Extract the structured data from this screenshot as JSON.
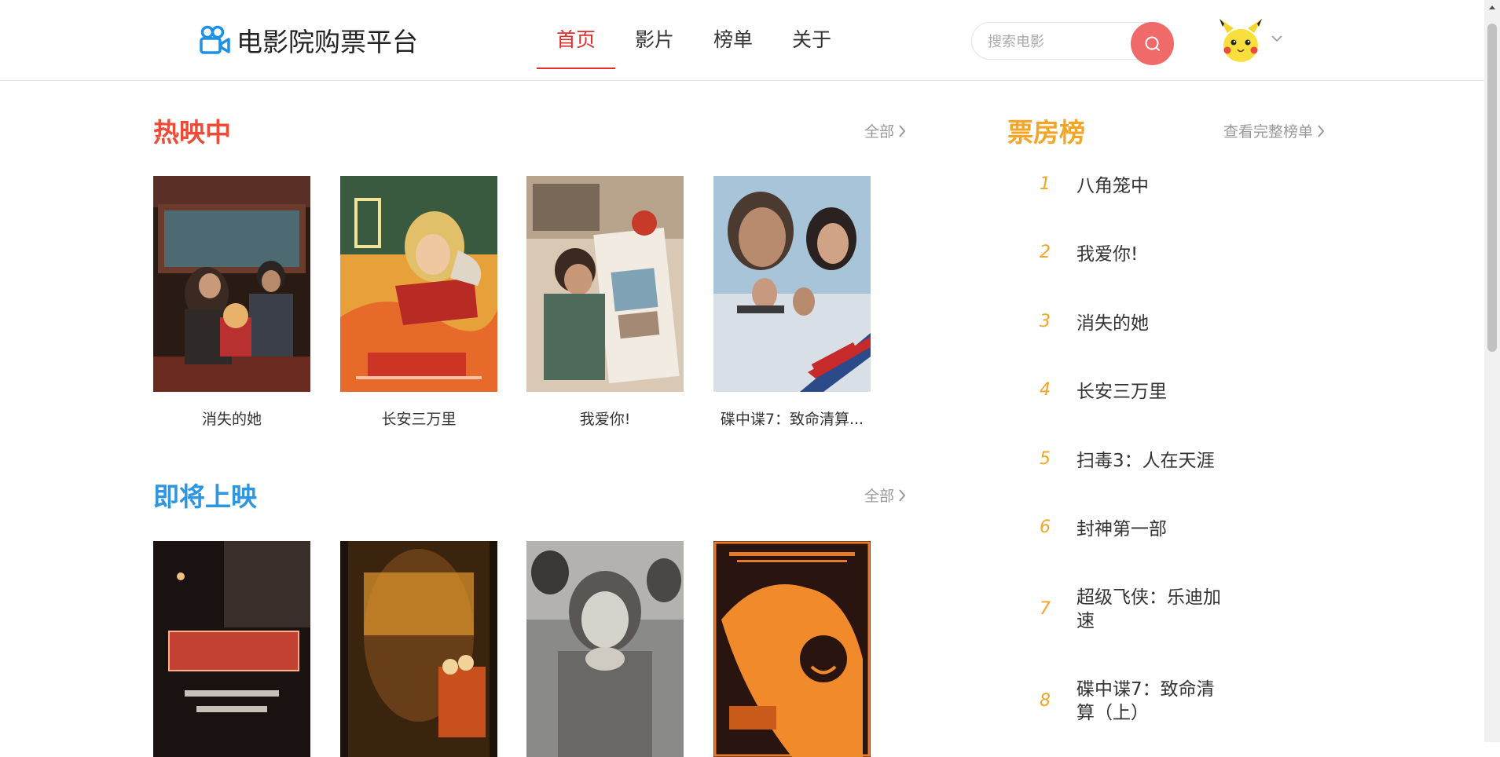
{
  "header": {
    "logo_text": "电影院购票平台",
    "nav": [
      {
        "label": "首页",
        "active": true
      },
      {
        "label": "影片",
        "active": false
      },
      {
        "label": "榜单",
        "active": false
      },
      {
        "label": "关于",
        "active": false
      }
    ],
    "search_placeholder": "搜索电影",
    "accent_color": "#e62b2b"
  },
  "hot": {
    "title": "热映中",
    "more": "全部",
    "movies": [
      {
        "name": "消失的她"
      },
      {
        "name": "长安三万里"
      },
      {
        "name": "我爱你!"
      },
      {
        "name": "碟中谍7：致命清算..."
      }
    ]
  },
  "upcoming": {
    "title": "即将上映",
    "more": "全部",
    "movies": [
      {
        "name": ""
      },
      {
        "name": ""
      },
      {
        "name": ""
      },
      {
        "name": ""
      }
    ]
  },
  "box_office": {
    "title": "票房榜",
    "more": "查看完整榜单",
    "items": [
      {
        "rank": "1",
        "name": "八角笼中"
      },
      {
        "rank": "2",
        "name": "我爱你!"
      },
      {
        "rank": "3",
        "name": "消失的她"
      },
      {
        "rank": "4",
        "name": "长安三万里"
      },
      {
        "rank": "5",
        "name": "扫毒3：人在天涯"
      },
      {
        "rank": "6",
        "name": "封神第一部"
      },
      {
        "rank": "7",
        "name": "超级飞侠：乐迪加速"
      },
      {
        "rank": "8",
        "name": "碟中谍7：致命清算（上）"
      }
    ]
  }
}
